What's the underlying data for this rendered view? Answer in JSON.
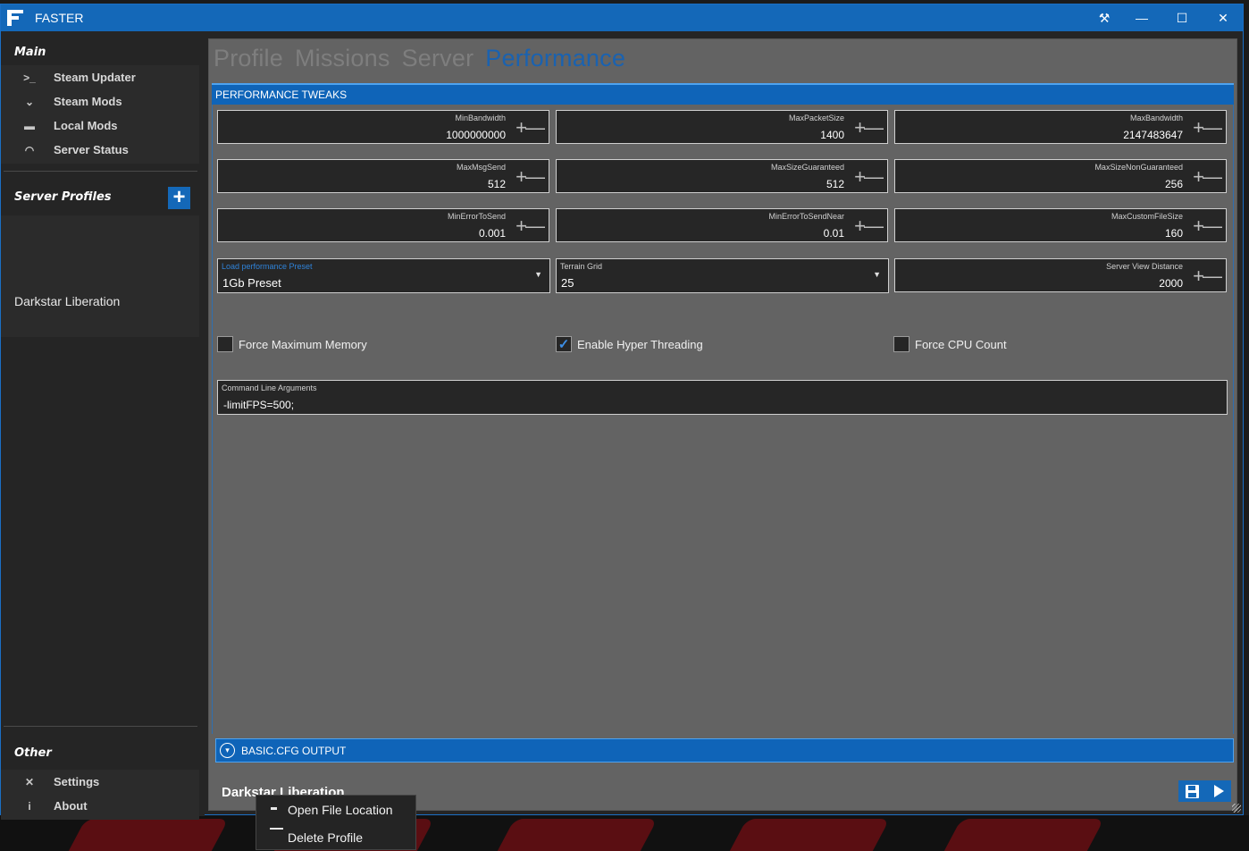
{
  "window": {
    "title": "FASTER",
    "buttons": {
      "tools": "⚒",
      "minimize": "—",
      "maximize": "☐",
      "close": "✕"
    }
  },
  "sidebar": {
    "main_label": "Main",
    "main_items": [
      {
        "label": "Steam Updater",
        "icon": ">_"
      },
      {
        "label": "Steam Mods",
        "icon": "⌄"
      },
      {
        "label": "Local Mods",
        "icon": "▬"
      },
      {
        "label": "Server Status",
        "icon": "◠"
      }
    ],
    "profiles_label": "Server Profiles",
    "add_profile": "+",
    "profiles": [
      "Darkstar Liberation"
    ],
    "other_label": "Other",
    "other_items": [
      {
        "label": "Settings",
        "icon": "✕"
      },
      {
        "label": "About",
        "icon": "i"
      }
    ]
  },
  "tabs": [
    "Profile",
    "Missions",
    "Server",
    "Performance"
  ],
  "active_tab": "Performance",
  "tweaks_header": "PERFORMANCE TWEAKS",
  "fields": [
    {
      "label": "MinBandwidth",
      "value": "1000000000"
    },
    {
      "label": "MaxPacketSize",
      "value": "1400"
    },
    {
      "label": "MaxBandwidth",
      "value": "2147483647"
    },
    {
      "label": "MaxMsgSend",
      "value": "512"
    },
    {
      "label": "MaxSizeGuaranteed",
      "value": "512"
    },
    {
      "label": "MaxSizeNonGuaranteed",
      "value": "256"
    },
    {
      "label": "MinErrorToSend",
      "value": "0.001"
    },
    {
      "label": "MinErrorToSendNear",
      "value": "0.01"
    },
    {
      "label": "MaxCustomFileSize",
      "value": "160"
    }
  ],
  "preset": {
    "label": "Load performance Preset",
    "value": "1Gb Preset"
  },
  "terrain_grid": {
    "label": "Terrain Grid",
    "value": "25"
  },
  "view_distance": {
    "label": "Server View Distance",
    "value": "2000"
  },
  "stepper": {
    "plus": "+",
    "minus": "—"
  },
  "checkboxes": [
    {
      "label": "Force Maximum Memory",
      "checked": false
    },
    {
      "label": "Enable Hyper Threading",
      "checked": true,
      "mark": "✓"
    },
    {
      "label": "Force CPU Count",
      "checked": false
    }
  ],
  "command_line": {
    "label": "Command Line Arguments",
    "value": "-limitFPS=500;"
  },
  "basic_cfg_label": "BASIC.CFG OUTPUT",
  "basic_cfg_chevron": "▾",
  "current_profile": "Darkstar Liberation",
  "context_menu": [
    "Open File Location",
    "Delete Profile"
  ],
  "colors": {
    "accent": "#1468b8",
    "panel": "#636363",
    "sidebar": "#252525"
  }
}
